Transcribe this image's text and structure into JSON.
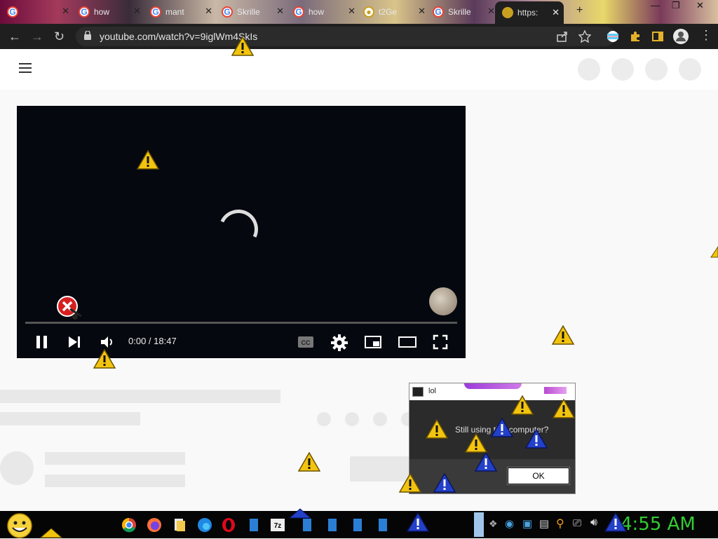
{
  "browser": {
    "tabs": [
      {
        "label": "",
        "active": false
      },
      {
        "label": "how",
        "active": false
      },
      {
        "label": "mant",
        "active": false
      },
      {
        "label": "Skrille",
        "active": false
      },
      {
        "label": "how",
        "active": false
      },
      {
        "label": "t2Ge",
        "active": false
      },
      {
        "label": "Skrille",
        "active": false
      },
      {
        "label": "https:",
        "active": true
      }
    ],
    "url": "youtube.com/watch?v=9iglWm4SkIs"
  },
  "player": {
    "time": "0:00 / 18:47",
    "progress": 0.0
  },
  "dialog": {
    "title": "lol",
    "message": "Still using this computer?",
    "ok_label": "OK"
  },
  "taskbar": {
    "clock": "4:55 AM"
  },
  "colors": {
    "clock": "#33cc33",
    "warning": "#f2c40f",
    "info": "#2340c8"
  }
}
